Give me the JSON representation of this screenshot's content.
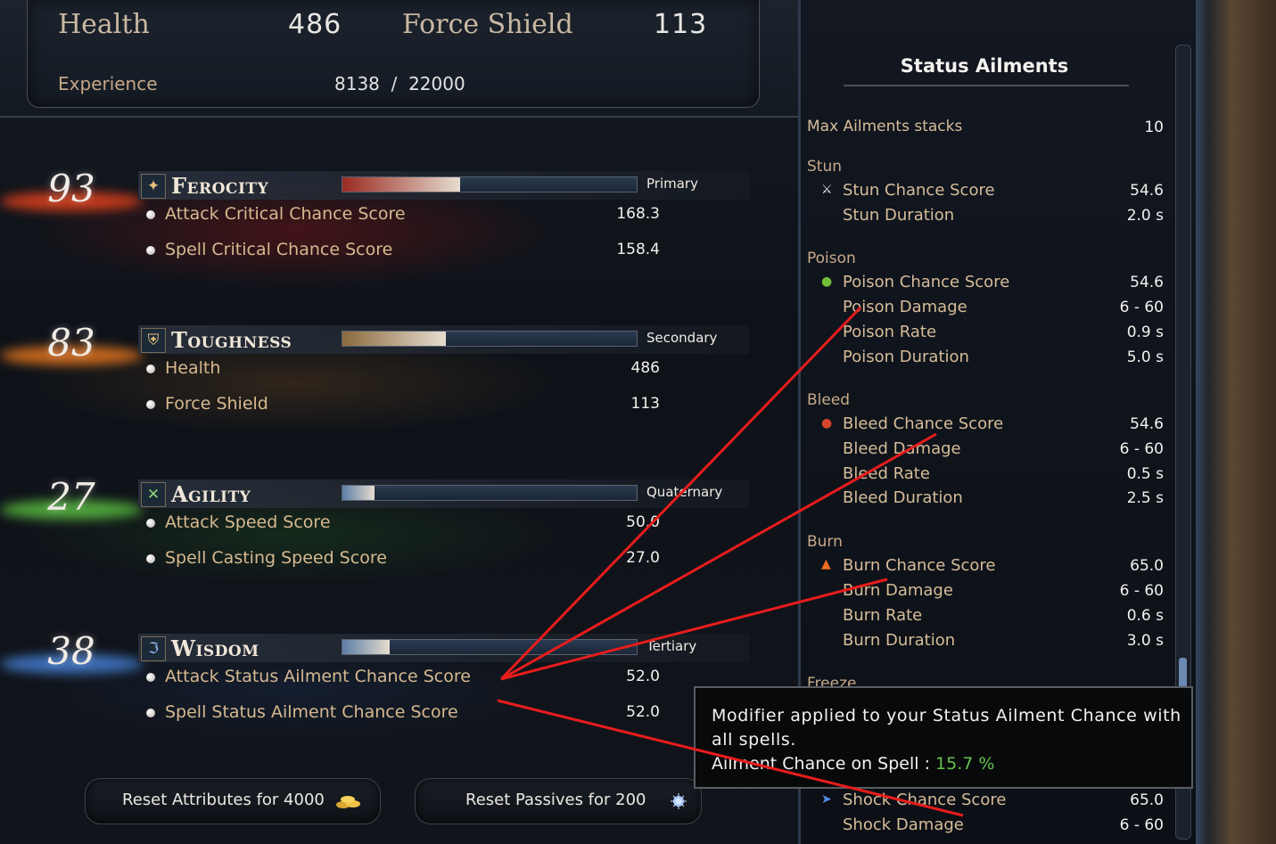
{
  "header": {
    "health_label": "Health",
    "health_value": "486",
    "shield_label": "Force Shield",
    "shield_value": "113",
    "experience_label": "Experience",
    "experience_value": "8138  /  22000"
  },
  "attributes": [
    {
      "level": "93",
      "name": "Ferocity",
      "rank": "Primary",
      "fill": 0.4,
      "color": "#9a2a22",
      "rows": [
        {
          "label": "Attack Critical Chance Score",
          "value": "168.3"
        },
        {
          "label": "Spell Critical Chance Score",
          "value": "158.4"
        }
      ]
    },
    {
      "level": "83",
      "name": "Toughness",
      "rank": "Secondary",
      "fill": 0.35,
      "color": "#8a6a3e",
      "rows": [
        {
          "label": "Health",
          "value": "486"
        },
        {
          "label": "Force Shield",
          "value": "113"
        }
      ]
    },
    {
      "level": "27",
      "name": "Agility",
      "rank": "Quaternary",
      "fill": 0.11,
      "color": "#5d7ea6",
      "rows": [
        {
          "label": "Attack Speed Score",
          "value": "50.0"
        },
        {
          "label": "Spell Casting Speed Score",
          "value": "27.0"
        }
      ]
    },
    {
      "level": "38",
      "name": "Wisdom",
      "rank": "Tertiary",
      "fill": 0.16,
      "color": "#5d7ea6",
      "rows": [
        {
          "label": "Attack Status Ailment Chance Score",
          "value": "52.0"
        },
        {
          "label": "Spell Status Ailment Chance Score",
          "value": "52.0"
        }
      ]
    }
  ],
  "buttons": {
    "reset_attributes": "Reset Attributes for 4000",
    "reset_passives": "Reset Passives for 200"
  },
  "status_ailments": {
    "title": "Status Ailments",
    "max_stacks_label": "Max Ailments stacks",
    "max_stacks_value": "10",
    "stun": {
      "group": "Stun",
      "chance_label": "Stun Chance Score",
      "chance_value": "54.6",
      "duration_label": "Stun Duration",
      "duration_value": "2.0 s"
    },
    "poison": {
      "group": "Poison",
      "chance_label": "Poison Chance Score",
      "chance_value": "54.6",
      "damage_label": "Poison Damage",
      "damage_value": "6 - 60",
      "rate_label": "Poison Rate",
      "rate_value": "0.9 s",
      "duration_label": "Poison Duration",
      "duration_value": "5.0 s"
    },
    "bleed": {
      "group": "Bleed",
      "chance_label": "Bleed Chance Score",
      "chance_value": "54.6",
      "damage_label": "Bleed Damage",
      "damage_value": "6 - 60",
      "rate_label": "Bleed Rate",
      "rate_value": "0.5 s",
      "duration_label": "Bleed Duration",
      "duration_value": "2.5 s"
    },
    "burn": {
      "group": "Burn",
      "chance_label": "Burn Chance Score",
      "chance_value": "65.0",
      "damage_label": "Burn Damage",
      "damage_value": "6 - 60",
      "rate_label": "Burn Rate",
      "rate_value": "0.6 s",
      "duration_label": "Burn Duration",
      "duration_value": "3.0 s"
    },
    "freeze": {
      "group": "Freeze"
    },
    "shock": {
      "chance_label": "Shock Chance Score",
      "chance_value": "65.0",
      "damage_label": "Shock Damage",
      "damage_value": "6 - 60"
    }
  },
  "tooltip": {
    "description": "Modifier applied to your Status Ailment Chance with all spells.",
    "stat_label": "Ailment Chance on Spell : ",
    "stat_value": "15.7 %"
  },
  "colors": {
    "annotation": "#e81c1c",
    "tooltip_value": "#64c24b"
  }
}
